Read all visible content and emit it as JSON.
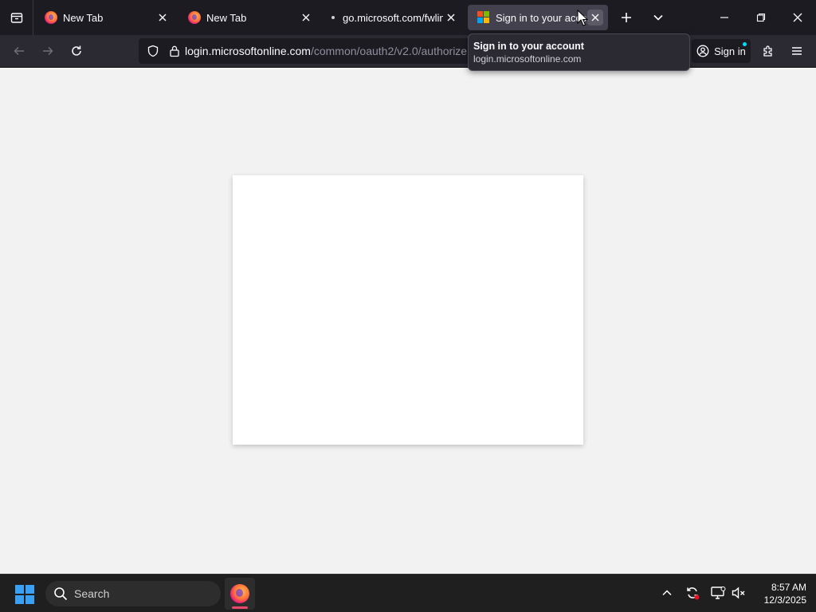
{
  "tabs": [
    {
      "title": "New Tab",
      "favicon": "firefox-icon",
      "active": false
    },
    {
      "title": "New Tab",
      "favicon": "firefox-icon",
      "active": false
    },
    {
      "title": "go.microsoft.com/fwlink",
      "favicon": "loading-dot-icon",
      "active": false
    },
    {
      "title": "Sign in to your account",
      "favicon": "microsoft-logo-icon",
      "active": true
    }
  ],
  "navbar": {
    "url_domain": "login.microsoftonline.com",
    "url_path": "/common/oauth2/v2.0/authorize",
    "signin_label": "Sign in"
  },
  "tooltip": {
    "title": "Sign in to your account",
    "url": "login.microsoftonline.com"
  },
  "taskbar": {
    "search_placeholder": "Search",
    "time": "8:57 AM",
    "date": "12/3/2025"
  },
  "colors": {
    "chrome_dark": "#1c1b22",
    "toolbar": "#2b2a33",
    "active_tab": "#42414d",
    "page_bg": "#f2f2f2",
    "card_bg": "#ffffff",
    "taskbar_bg": "#1f1f1f",
    "windows_blue": "#3aa0f3",
    "ms_red": "#f25022",
    "ms_green": "#7fba00",
    "ms_blue": "#00a4ef",
    "ms_yellow": "#ffb900"
  }
}
